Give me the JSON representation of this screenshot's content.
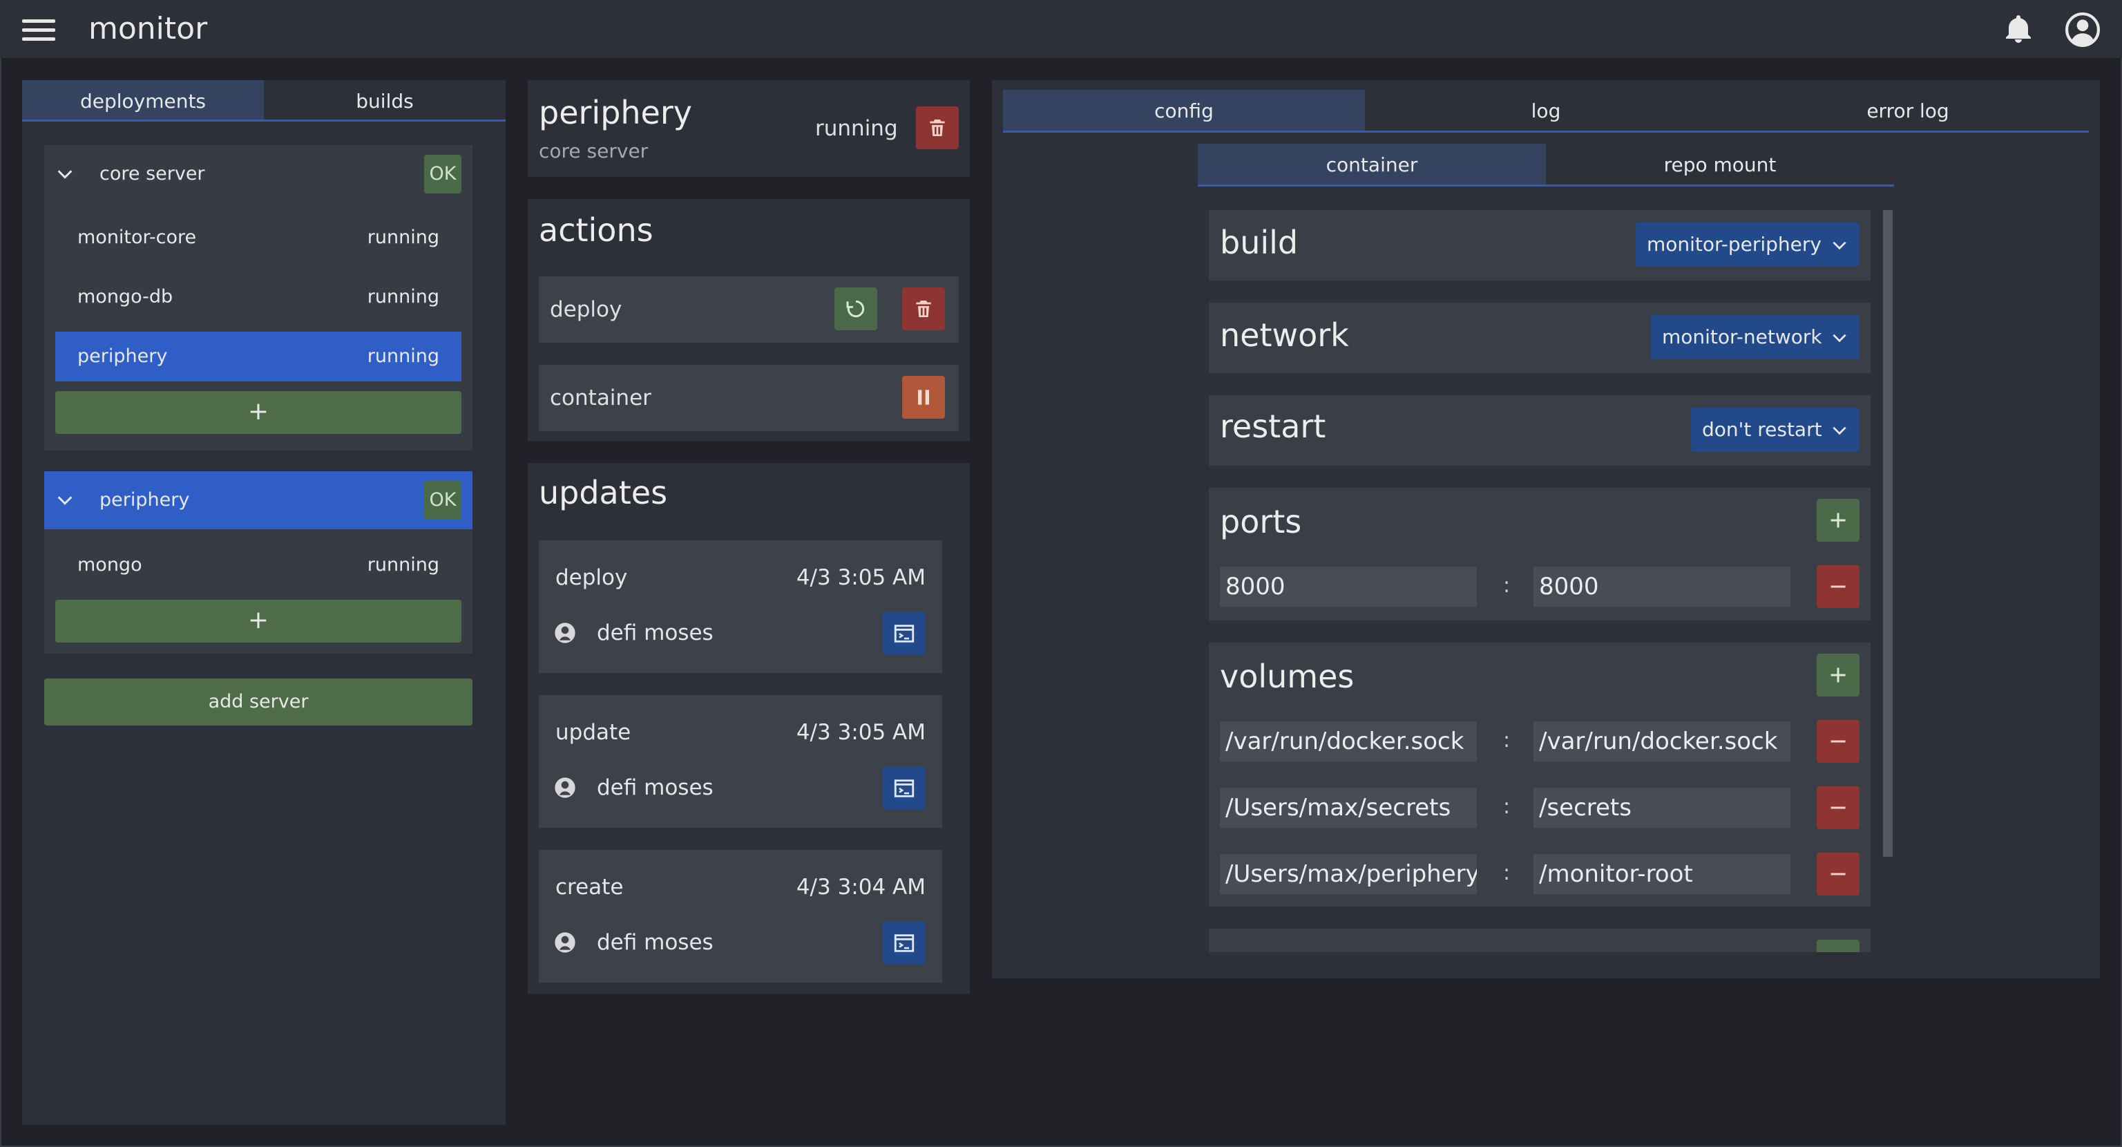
{
  "app": {
    "title": "monitor"
  },
  "sidebar": {
    "tabs": [
      "deployments",
      "builds"
    ],
    "servers": [
      {
        "name": "core server",
        "status": "OK",
        "deployments": [
          {
            "name": "monitor-core",
            "status": "running"
          },
          {
            "name": "mongo-db",
            "status": "running"
          },
          {
            "name": "periphery",
            "status": "running",
            "selected": true
          }
        ],
        "add_label": "+"
      },
      {
        "name": "periphery",
        "status": "OK",
        "selected": true,
        "deployments": [
          {
            "name": "mongo",
            "status": "running"
          }
        ],
        "add_label": "+"
      }
    ],
    "add_server_label": "add server"
  },
  "deployment": {
    "name": "periphery",
    "server": "core server",
    "status": "running"
  },
  "actions": {
    "title": "actions",
    "rows": [
      {
        "label": "deploy"
      },
      {
        "label": "container"
      }
    ]
  },
  "updates": {
    "title": "updates",
    "items": [
      {
        "operation": "deploy",
        "time": "4/3 3:05 AM",
        "user": "defi moses"
      },
      {
        "operation": "update",
        "time": "4/3 3:05 AM",
        "user": "defi moses"
      },
      {
        "operation": "create",
        "time": "4/3 3:04 AM",
        "user": "defi moses"
      }
    ]
  },
  "config": {
    "tabs": [
      "config",
      "log",
      "error log"
    ],
    "subtabs": [
      "container",
      "repo mount"
    ],
    "build": {
      "title": "build",
      "value": "monitor-periphery"
    },
    "network": {
      "title": "network",
      "value": "monitor-network"
    },
    "restart": {
      "title": "restart",
      "value": "don't restart"
    },
    "ports": {
      "title": "ports",
      "rows": [
        {
          "host": "8000",
          "container": "8000"
        }
      ]
    },
    "volumes": {
      "title": "volumes",
      "rows": [
        {
          "host": "/var/run/docker.sock",
          "container": "/var/run/docker.sock"
        },
        {
          "host": "/Users/max/secrets",
          "container": "/secrets"
        },
        {
          "host": "/Users/max/periphery",
          "container": "/monitor-root"
        }
      ]
    },
    "separator": ":"
  },
  "colors": {
    "accent": "#2f5fc6",
    "ok": "#4a6a48",
    "danger": "#8e3531",
    "warning": "#b1583a",
    "panel": "#2d3038"
  },
  "icons": [
    "menu-icon",
    "bell-icon",
    "user-icon",
    "chevron-down-icon",
    "trash-icon",
    "restart-icon",
    "pause-icon",
    "user-circle-icon",
    "terminal-icon",
    "plus-icon",
    "minus-icon"
  ]
}
